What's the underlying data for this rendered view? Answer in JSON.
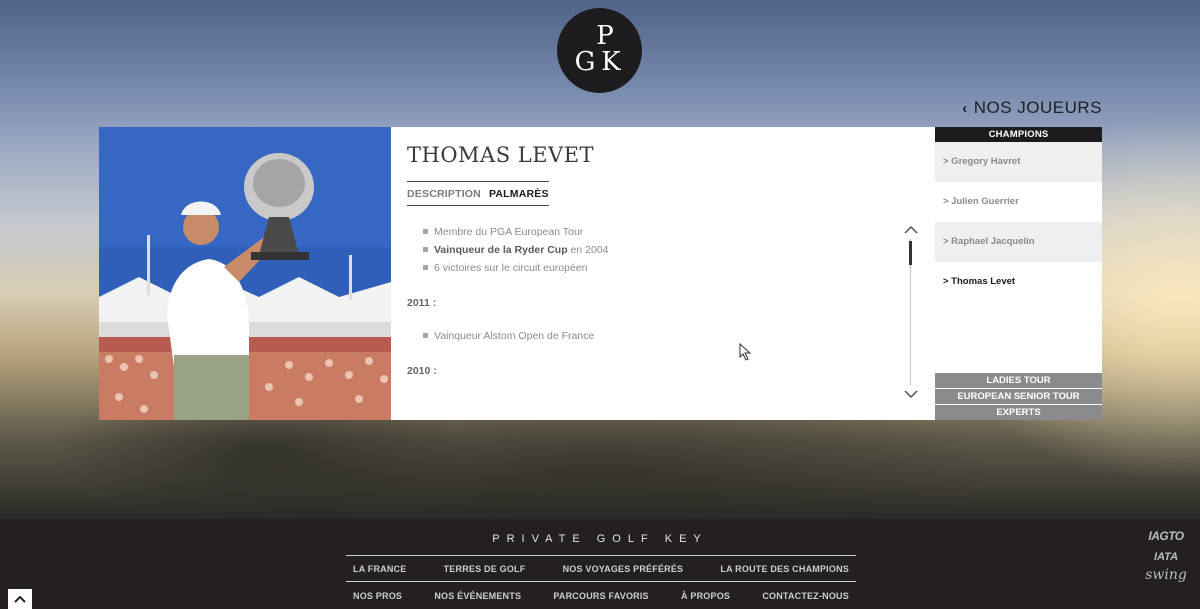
{
  "logo": {
    "letters": "GPK",
    "letter_top": "P",
    "letter_left": "G",
    "letter_right": "K"
  },
  "nav": {
    "back_label": "NOS JOUEURS"
  },
  "player": {
    "name": "THOMAS LEVET",
    "tabs": [
      {
        "label": "DESCRIPTION",
        "active": false
      },
      {
        "label": "PALMARÈS",
        "active": true
      }
    ],
    "highlights": [
      {
        "text": "Membre du PGA European Tour"
      },
      {
        "bold": "Vainqueur de la Ryder Cup",
        "text": " en 2004"
      },
      {
        "text": "6 victoires sur le circuit européen"
      }
    ],
    "years": [
      {
        "year": "2011 :",
        "items": [
          "Vainqueur Alstom Open de France"
        ]
      },
      {
        "year": "2010 :",
        "items": []
      }
    ]
  },
  "sidebar": {
    "header": "CHAMPIONS",
    "players": [
      {
        "label": "> Gregory Havret",
        "active": false
      },
      {
        "label": "> Julien Guerrier",
        "active": false
      },
      {
        "label": "> Raphael Jacquelin",
        "active": false
      },
      {
        "label": "> Thomas Levet",
        "active": true
      }
    ],
    "categories": [
      "LADIES TOUR",
      "EUROPEAN SENIOR TOUR",
      "EXPERTS"
    ]
  },
  "footer": {
    "brand": "PRIVATE GOLF KEY",
    "nav_row1": [
      "LA FRANCE",
      "TERRES DE GOLF",
      "NOS VOYAGES PRÉFÉRÉS",
      "LA ROUTE DES CHAMPIONS"
    ],
    "nav_row2": [
      "NOS PROS",
      "NOS ÉVÉNEMENTS",
      "PARCOURS FAVORIS",
      "À PROPOS",
      "CONTACTEZ-NOUS"
    ],
    "partners": [
      "IAGTO",
      "IATA",
      "swing"
    ]
  },
  "colors": {
    "dark": "#1c1c1e",
    "grey_tab": "#8b8b8d",
    "footer": "#231f22"
  }
}
